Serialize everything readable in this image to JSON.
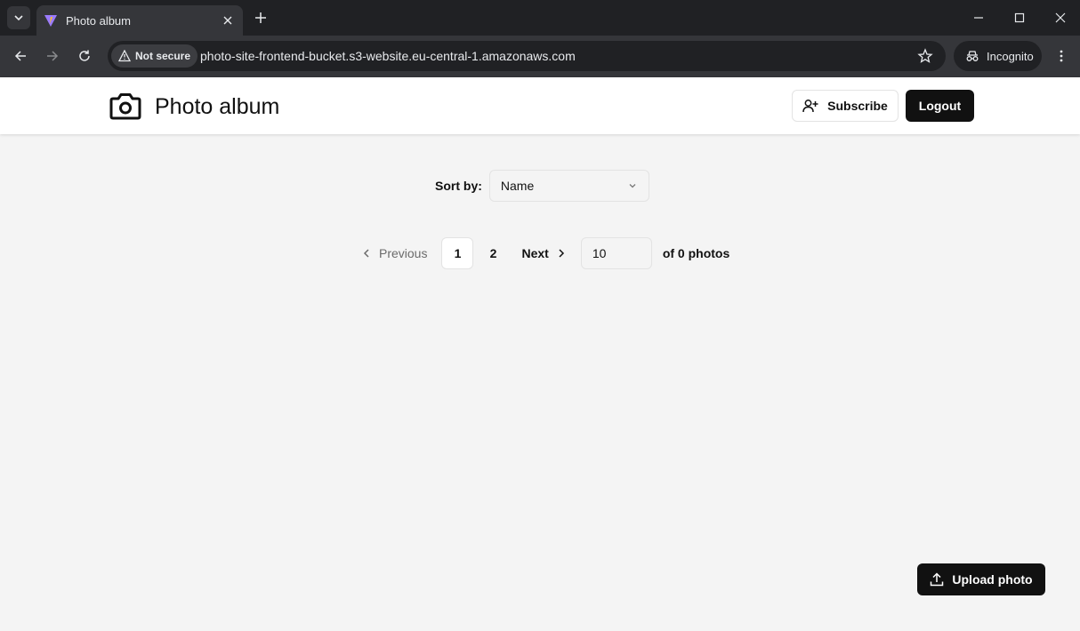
{
  "browser": {
    "tab_title": "Photo album",
    "security_label": "Not secure",
    "url": "photo-site-frontend-bucket.s3-website.eu-central-1.amazonaws.com",
    "profile_label": "Incognito"
  },
  "header": {
    "title": "Photo album",
    "icon": "camera-icon",
    "subscribe_label": "Subscribe",
    "logout_label": "Logout"
  },
  "sort": {
    "label": "Sort by:",
    "selected": "Name"
  },
  "pagination": {
    "previous_label": "Previous",
    "pages": [
      "1",
      "2"
    ],
    "current_page": "1",
    "next_label": "Next",
    "per_page": "10",
    "total_text": "of 0 photos"
  },
  "upload": {
    "label": "Upload photo"
  },
  "colors": {
    "primary": "#111111",
    "background": "#f4f4f4",
    "chrome_dark": "#202124",
    "chrome_toolbar": "#35363a"
  }
}
